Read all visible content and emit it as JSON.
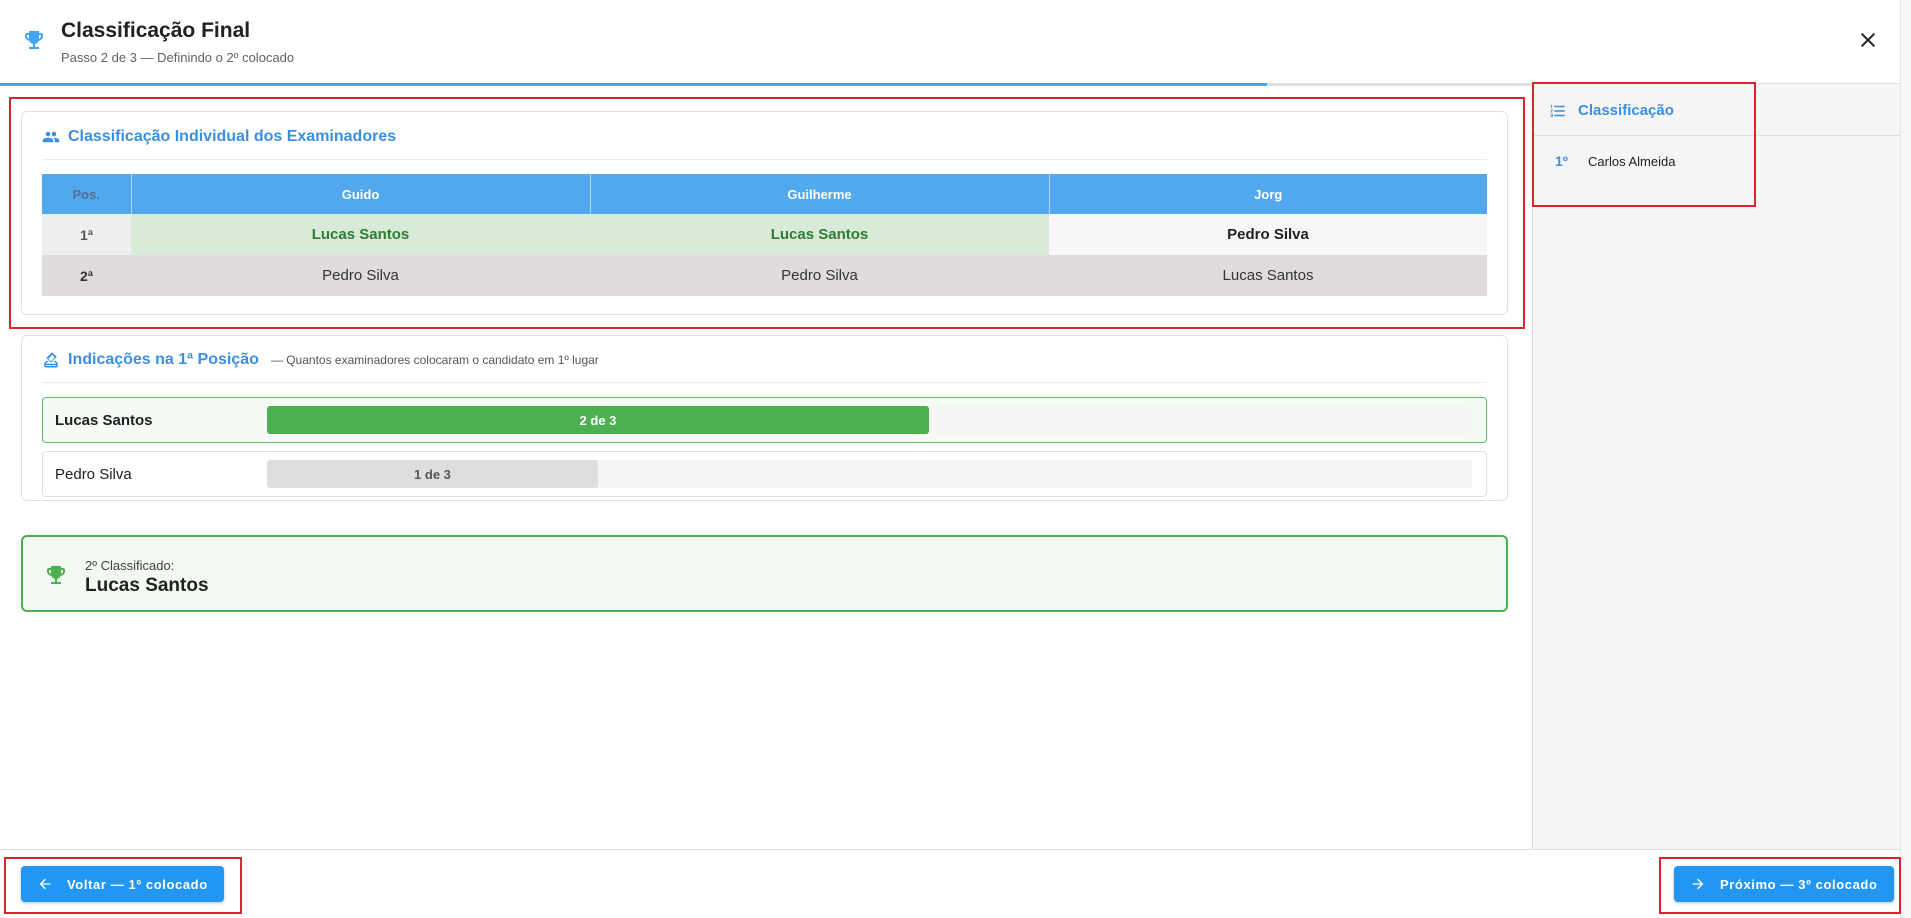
{
  "header": {
    "title": "Classificação Final",
    "subtitle": "Passo 2 de 3 — Definindo o 2º colocado",
    "progress_fraction": 0.667
  },
  "individual": {
    "title": "Classificação Individual dos Examinadores",
    "headers": [
      "Pos.",
      "Guido",
      "Guilherme",
      "Jorg"
    ],
    "rows": [
      {
        "pos": "1ª",
        "cells": [
          "Lucas Santos",
          "Lucas Santos",
          "Pedro Silva"
        ]
      },
      {
        "pos": "2ª",
        "cells": [
          "Pedro Silva",
          "Pedro Silva",
          "Lucas Santos"
        ]
      }
    ]
  },
  "votes": {
    "title": "Indicações na 1ª Posição",
    "note": "— Quantos examinadores colocaram o candidato em 1º lugar",
    "items": [
      {
        "name": "Lucas Santos",
        "label": "2 de 3",
        "count": 2,
        "total": 3
      },
      {
        "name": "Pedro Silva",
        "label": "1 de 3",
        "count": 1,
        "total": 3
      }
    ]
  },
  "result": {
    "label": "2º Classificado:",
    "name": "Lucas Santos"
  },
  "sidebar": {
    "title": "Classificação",
    "items": [
      {
        "pos": "1º",
        "name": "Carlos Almeida"
      }
    ]
  },
  "footer": {
    "back_label": "Voltar — 1º colocado",
    "next_label": "Próximo — 3º colocado"
  },
  "colors": {
    "accent": "#2196f3",
    "table_header": "#52a8ee",
    "success": "#4caf50",
    "success_text": "#2e7d32",
    "highlight_box": "#d9262e"
  },
  "icons": {
    "header": "trophy-icon",
    "close": "close-icon",
    "individual": "group-icon",
    "votes": "ballot-icon",
    "result": "trophy-icon",
    "sidebar": "list-icon",
    "back": "arrow-left-icon",
    "next": "arrow-right-icon"
  }
}
